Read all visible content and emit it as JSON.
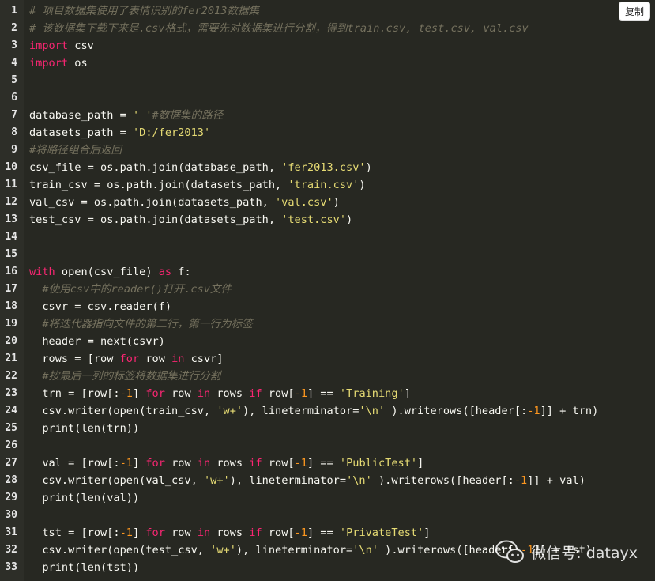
{
  "toolbar": {
    "copy_label": "复制"
  },
  "watermark": {
    "text": "微信号: datayx"
  },
  "code_lines": [
    [
      [
        "cm",
        "# 项目数据集使用了表情识别的fer2013数据集"
      ]
    ],
    [
      [
        "cm",
        "# 该数据集下载下来是.csv格式，需要先对数据集进行分割，得到train.csv, test.csv, val.csv"
      ]
    ],
    [
      [
        "kw",
        "import"
      ],
      [
        "",
        "  csv"
      ]
    ],
    [
      [
        "kw",
        "import"
      ],
      [
        "",
        "  os"
      ]
    ],
    [],
    [],
    [
      [
        "",
        "database_path = "
      ],
      [
        "str",
        "'  '"
      ],
      [
        "cm",
        "#数据集的路径"
      ]
    ],
    [
      [
        "",
        "datasets_path = "
      ],
      [
        "str",
        "'D:/fer2013'"
      ]
    ],
    [
      [
        "cm",
        "#将路径组合后返回"
      ]
    ],
    [
      [
        "",
        "csv_file = os.path.join(database_path, "
      ],
      [
        "str",
        "'fer2013.csv'"
      ],
      [
        "",
        ")"
      ]
    ],
    [
      [
        "",
        "train_csv = os.path.join(datasets_path, "
      ],
      [
        "str",
        "'train.csv'"
      ],
      [
        "",
        ")"
      ]
    ],
    [
      [
        "",
        "val_csv = os.path.join(datasets_path, "
      ],
      [
        "str",
        "'val.csv'"
      ],
      [
        "",
        ")"
      ]
    ],
    [
      [
        "",
        "test_csv = os.path.join(datasets_path, "
      ],
      [
        "str",
        "'test.csv'"
      ],
      [
        "",
        ")"
      ]
    ],
    [],
    [],
    [
      [
        "kw",
        "with"
      ],
      [
        "",
        "  open(csv_file) "
      ],
      [
        "kw",
        "as"
      ],
      [
        "",
        "  f:"
      ]
    ],
    [
      [
        "",
        "    "
      ],
      [
        "cm",
        "#使用csv中的reader()打开.csv文件"
      ]
    ],
    [
      [
        "",
        "    csvr = csv.reader(f)"
      ]
    ],
    [
      [
        "",
        "    "
      ],
      [
        "cm",
        "#将迭代器指向文件的第二行，第一行为标签"
      ]
    ],
    [
      [
        "",
        "    header = next(csvr)"
      ]
    ],
    [
      [
        "",
        "    rows = [row "
      ],
      [
        "kw",
        "for"
      ],
      [
        "",
        "  row "
      ],
      [
        "kw",
        "in"
      ],
      [
        "",
        "  csvr]"
      ]
    ],
    [
      [
        "",
        "    "
      ],
      [
        "cm",
        "#按最后一列的标签将数据集进行分割"
      ]
    ],
    [
      [
        "",
        "    trn = [row[:"
      ],
      [
        "num",
        "-1"
      ],
      [
        "",
        "] "
      ],
      [
        "kw",
        "for"
      ],
      [
        "",
        "  row "
      ],
      [
        "kw",
        "in"
      ],
      [
        "",
        "  rows "
      ],
      [
        "kw",
        "if"
      ],
      [
        "",
        "  row["
      ],
      [
        "num",
        "-1"
      ],
      [
        "",
        "] == "
      ],
      [
        "str",
        "'Training'"
      ],
      [
        "",
        "]"
      ]
    ],
    [
      [
        "",
        "    csv.writer(open(train_csv, "
      ],
      [
        "str",
        "'w+'"
      ],
      [
        "",
        "), lineterminator="
      ],
      [
        "str",
        "'\\n'"
      ],
      [
        "",
        "  ).writerows([header[:"
      ],
      [
        "num",
        "-1"
      ],
      [
        "",
        "]] + trn)"
      ]
    ],
    [
      [
        "",
        "    print(len(trn))"
      ]
    ],
    [],
    [
      [
        "",
        "    val = [row[:"
      ],
      [
        "num",
        "-1"
      ],
      [
        "",
        "] "
      ],
      [
        "kw",
        "for"
      ],
      [
        "",
        "  row "
      ],
      [
        "kw",
        "in"
      ],
      [
        "",
        "  rows "
      ],
      [
        "kw",
        "if"
      ],
      [
        "",
        "  row["
      ],
      [
        "num",
        "-1"
      ],
      [
        "",
        "] == "
      ],
      [
        "str",
        "'PublicTest'"
      ],
      [
        "",
        "]"
      ]
    ],
    [
      [
        "",
        "    csv.writer(open(val_csv, "
      ],
      [
        "str",
        "'w+'"
      ],
      [
        "",
        "), lineterminator="
      ],
      [
        "str",
        "'\\n'"
      ],
      [
        "",
        "  ).writerows([header[:"
      ],
      [
        "num",
        "-1"
      ],
      [
        "",
        "]] + val)"
      ]
    ],
    [
      [
        "",
        "    print(len(val))"
      ]
    ],
    [],
    [
      [
        "",
        "    tst = [row[:"
      ],
      [
        "num",
        "-1"
      ],
      [
        "",
        "] "
      ],
      [
        "kw",
        "for"
      ],
      [
        "",
        "  row "
      ],
      [
        "kw",
        "in"
      ],
      [
        "",
        "  rows "
      ],
      [
        "kw",
        "if"
      ],
      [
        "",
        "  row["
      ],
      [
        "num",
        "-1"
      ],
      [
        "",
        "] == "
      ],
      [
        "str",
        "'PrivateTest'"
      ],
      [
        "",
        "]"
      ]
    ],
    [
      [
        "",
        "    csv.writer(open(test_csv, "
      ],
      [
        "str",
        "'w+'"
      ],
      [
        "",
        "), lineterminator="
      ],
      [
        "str",
        "'\\n'"
      ],
      [
        "",
        "  ).writerows([header[:"
      ],
      [
        "num",
        "-1"
      ],
      [
        "",
        "]] + tst)"
      ]
    ],
    [
      [
        "",
        "    print(len(tst))"
      ]
    ]
  ],
  "colors": {
    "background": "#272822",
    "keyword": "#f92672",
    "string": "#e6db74",
    "number": "#fd971f",
    "comment": "#75715e",
    "text": "#f8f8f2"
  }
}
